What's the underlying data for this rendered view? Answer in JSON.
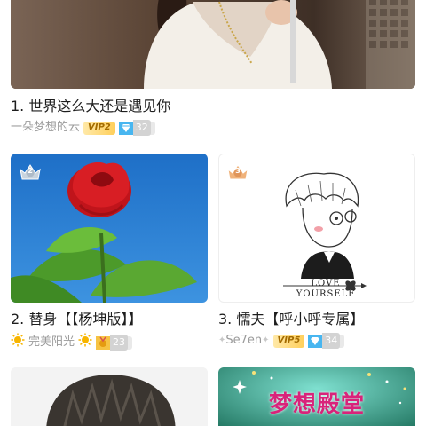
{
  "items": [
    {
      "rank_title": "1. 世界这么大还是遇见你",
      "author": "一朵梦想的云",
      "vip": "VIP2",
      "gems": "32"
    },
    {
      "rank_title": "2. 替身【【杨坤版】】",
      "author": "完美阳光",
      "gems": "23",
      "crown_num": "2"
    },
    {
      "rank_title": "3. 懦夫【呼小呼专属】",
      "author": "Se7en",
      "vip": "VIP5",
      "gems": "34",
      "crown_num": "3",
      "cover_text": "LOVE YOURSELF"
    },
    {
      "cover_text": "梦想殿堂"
    }
  ],
  "colors": {
    "vip_gold": "#ffcf5a",
    "crown_silver": "#c9d4de",
    "crown_bronze": "#f0b27a"
  }
}
